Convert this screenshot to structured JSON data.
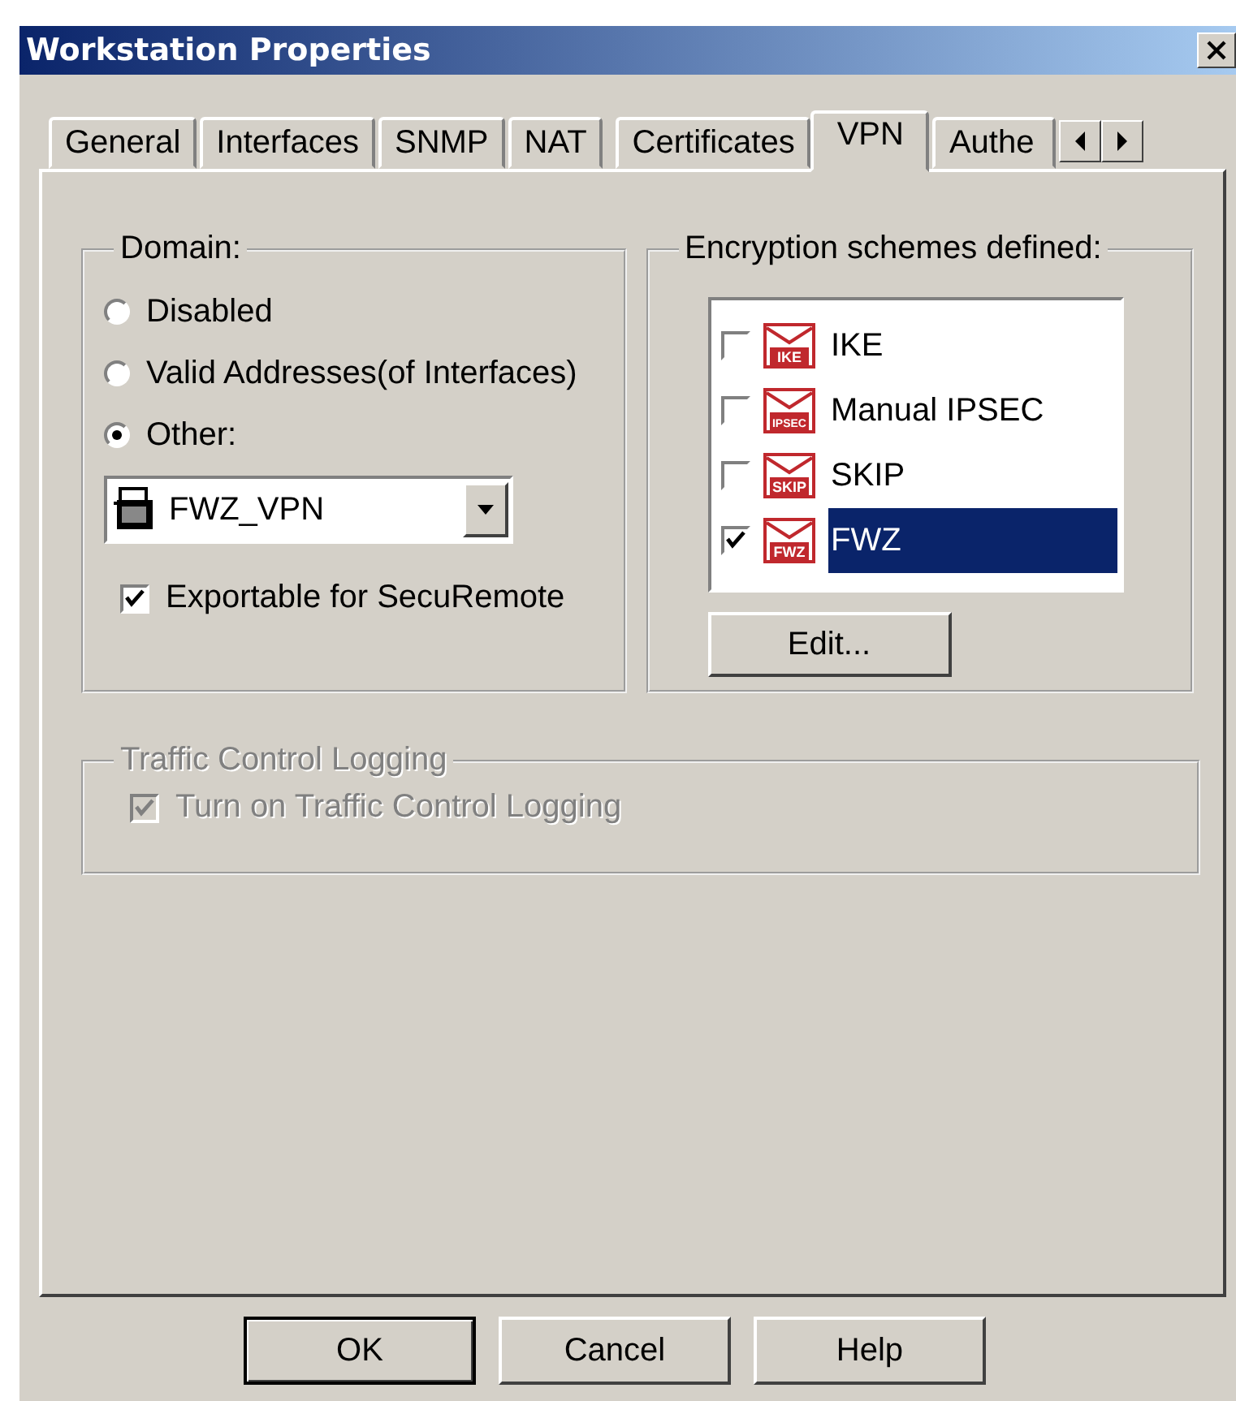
{
  "window": {
    "title": "Workstation Properties"
  },
  "tabs": [
    {
      "label": "General",
      "selected": false
    },
    {
      "label": "Interfaces",
      "selected": false
    },
    {
      "label": "SNMP",
      "selected": false
    },
    {
      "label": "NAT",
      "selected": false
    },
    {
      "label": "Certificates",
      "selected": false
    },
    {
      "label": "VPN",
      "selected": true
    },
    {
      "label": "Authe",
      "selected": false
    }
  ],
  "domain": {
    "title": "Domain:",
    "options": [
      {
        "label": "Disabled",
        "selected": false
      },
      {
        "label": "Valid Addresses(of Interfaces)",
        "selected": false
      },
      {
        "label": "Other:",
        "selected": true
      }
    ],
    "dropdown": {
      "value": "FWZ_VPN"
    },
    "exportable": {
      "label": "Exportable for SecuRemote",
      "checked": true
    }
  },
  "encryption": {
    "title": "Encryption schemes defined:",
    "schemes": [
      {
        "label": "IKE",
        "icon_label": "IKE",
        "checked": false,
        "selected": false
      },
      {
        "label": "Manual IPSEC",
        "icon_label": "IPSEC",
        "checked": false,
        "selected": false
      },
      {
        "label": "SKIP",
        "icon_label": "SKIP",
        "checked": false,
        "selected": false
      },
      {
        "label": "FWZ",
        "icon_label": "FWZ",
        "checked": true,
        "selected": true
      }
    ],
    "edit_button": "Edit..."
  },
  "traffic": {
    "title": "Traffic Control Logging",
    "disabled": true,
    "checkbox": {
      "label": "Turn on Traffic Control Logging",
      "checked": true
    }
  },
  "buttons": [
    {
      "label": "OK",
      "default": true
    },
    {
      "label": "Cancel",
      "default": false
    },
    {
      "label": "Help",
      "default": false
    }
  ]
}
